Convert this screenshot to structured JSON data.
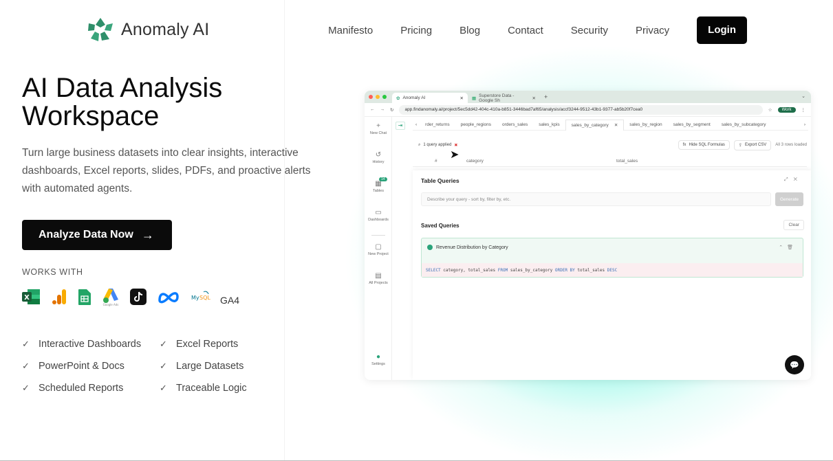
{
  "header": {
    "brand": "Anomaly AI",
    "nav": [
      "Manifesto",
      "Pricing",
      "Blog",
      "Contact",
      "Security",
      "Privacy"
    ],
    "login_label": "Login"
  },
  "hero": {
    "title": "AI Data Analysis Workspace",
    "subtitle": "Turn large business datasets into clear insights, interactive dashboards, Excel reports, slides, PDFs, and proactive alerts with automated agents.",
    "cta_label": "Analyze Data Now",
    "works_with_label": "WORKS WITH",
    "integrations": [
      "excel-icon",
      "google-analytics-icon",
      "google-sheets-icon",
      "google-ads-icon",
      "tiktok-icon",
      "meta-icon",
      "mysql-icon"
    ],
    "ga4_label": "GA4",
    "features": [
      "Interactive Dashboards",
      "Excel Reports",
      "PowerPoint & Docs",
      "Large Datasets",
      "Scheduled Reports",
      "Traceable Logic"
    ]
  },
  "mock": {
    "browser_tabs": [
      "Anomaly AI",
      "Superstore Data - Google Sh"
    ],
    "url": "app.findanomaly.ai/project/5ec5dd42-404c-410a-b851-3446bad7af65/analysis/accf3244-9512-43b1-9377-ab5b20f7cea0",
    "profile": "Work",
    "sidebar": [
      "New Chat",
      "History",
      "Tables",
      "Dashboards",
      "New Project",
      "All Projects",
      "Settings"
    ],
    "tables_badge": "14",
    "sheet_tabs": [
      "rder_returns",
      "people_regions",
      "orders_sales",
      "sales_kpis",
      "sales_by_category",
      "sales_by_region",
      "sales_by_segment",
      "sales_by_subcategory"
    ],
    "query_applied": "1 query applied",
    "hide_sql": "Hide SQL Formulas",
    "export_csv": "Export CSV",
    "rows_loaded": "All 3 rows loaded",
    "columns": [
      "#",
      "category",
      "total_sales"
    ],
    "modal_title": "Table Queries",
    "query_placeholder": "Describe your query - sort by, filter by, etc.",
    "generate_label": "Generate",
    "saved_title": "Saved Queries",
    "clear_label": "Clear",
    "saved_query_name": "Revenue Distribution by Category",
    "sql": {
      "k1": "SELECT",
      "p1": " category, total_sales ",
      "k2": "FROM",
      "p2": " sales_by_category ",
      "k3": "ORDER BY",
      "p3": " total_sales ",
      "k4": "DESC"
    }
  },
  "colors": {
    "accent": "#2aa37a",
    "glow": "#50f0d2",
    "dark": "#0b0b0b"
  }
}
